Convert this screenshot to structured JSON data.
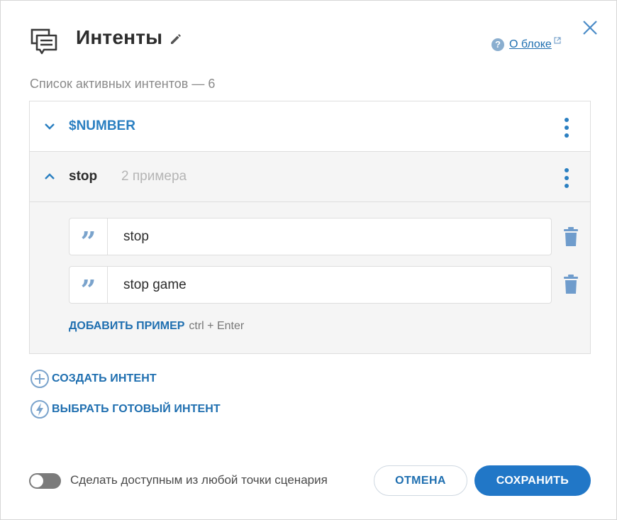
{
  "header": {
    "title": "Интенты",
    "about_label": "О блоке",
    "icons": {
      "header": "chat-icon",
      "edit": "pencil-icon",
      "close": "close-icon",
      "help": "question-icon",
      "external": "external-link-icon"
    },
    "help_symbol": "?"
  },
  "subtitle": "Список активных интентов — 6",
  "intents": [
    {
      "name": "$NUMBER",
      "expanded": false
    },
    {
      "name": "stop",
      "count": "2 примера",
      "expanded": true,
      "examples": [
        {
          "text": "stop"
        },
        {
          "text": "stop game"
        }
      ]
    }
  ],
  "add_example": {
    "label": "ДОБАВИТЬ ПРИМЕР",
    "hint": "ctrl + Enter"
  },
  "actions": {
    "create": "СОЗДАТЬ ИНТЕНТ",
    "choose": "ВЫБРАТЬ ГОТОВЫЙ ИНТЕНТ"
  },
  "footer": {
    "toggle_label": "Сделать доступным из любой точки сценария",
    "toggle_on": false,
    "cancel": "ОТМЕНА",
    "save": "СОХРАНИТЬ"
  },
  "colors": {
    "accent": "#2177c7",
    "link": "#1f6fb0",
    "icon_light": "#7aa3cc"
  }
}
